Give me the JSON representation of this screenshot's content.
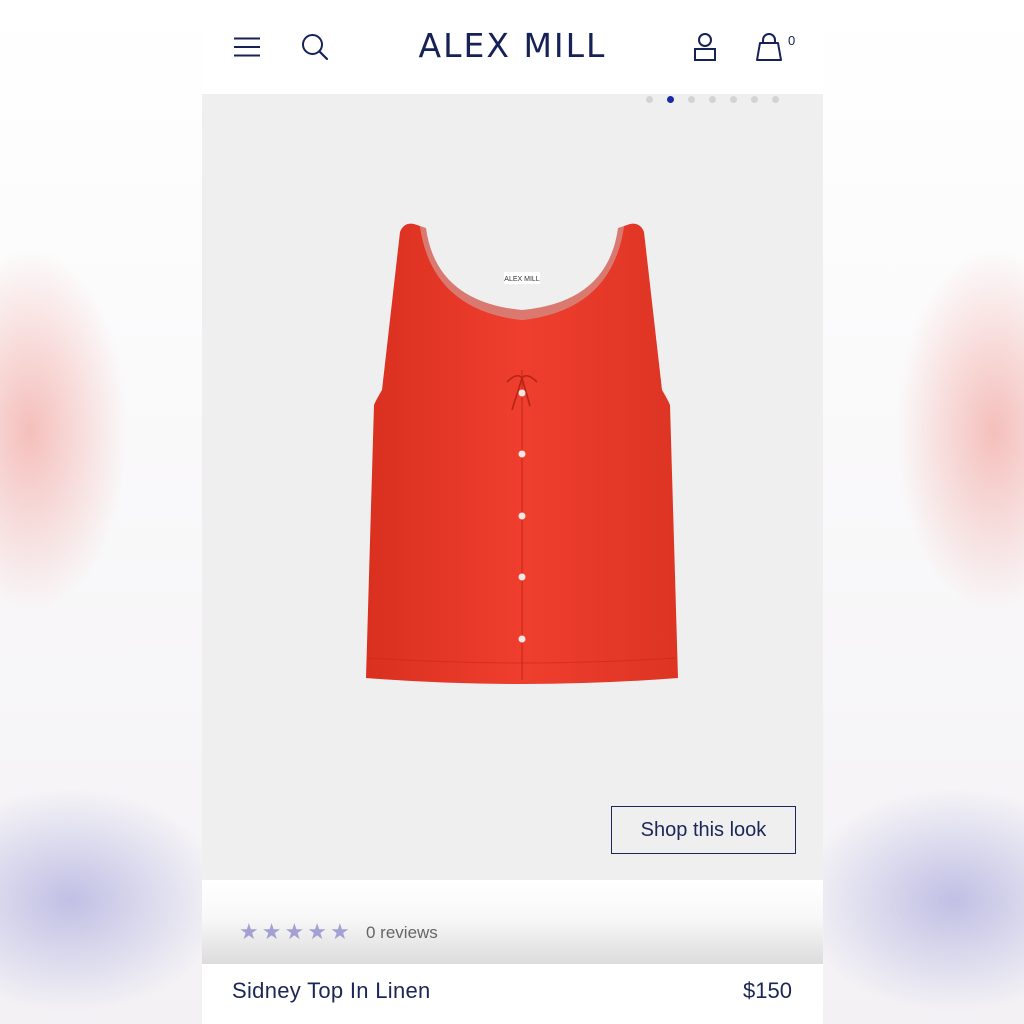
{
  "header": {
    "brand": "ALEX MILL",
    "cart_count": "0",
    "icons": [
      "menu-icon",
      "search-icon",
      "account-icon",
      "shopping-bag-icon"
    ]
  },
  "gallery": {
    "slide_count": 7,
    "active_slide": 2,
    "image_alt": "Red linen sleeveless top with tie neckline and front buttons",
    "label_text": "ALEX MILL",
    "shop_look_label": "Shop this look"
  },
  "reviews": {
    "rating": 0,
    "max_rating": 5,
    "count_label": "0 reviews",
    "star_color": "#a3a1d4"
  },
  "product": {
    "name": "Sidney Top In Linen",
    "price": "$150",
    "color": "#e8392c"
  },
  "colors": {
    "brand_navy": "#162158",
    "active_dot": "#1a2aa8"
  }
}
